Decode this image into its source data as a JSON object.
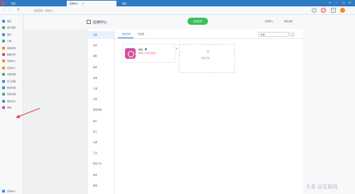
{
  "tabs": [
    {
      "label": "首页"
    },
    {
      "label": "应用中心",
      "close": "✕"
    },
    {
      "label": "审批"
    }
  ],
  "window": {
    "menu": "≡",
    "minimize": "–",
    "maximize": "□",
    "close": "✕"
  },
  "addressbar": {
    "crumb": "首页应用 · 应用中心",
    "badge": "11"
  },
  "sidebar": {
    "collapse": "«",
    "items": [
      {
        "label": "首页",
        "color": "#3c8be0"
      },
      {
        "label": "客户经营",
        "color": "#3cb37a"
      },
      {
        "label": "通讯",
        "color": "#3c8be0"
      },
      {
        "label": "订单",
        "color": "#3cb37a"
      },
      {
        "label": "审批应用",
        "color": "#f08a24"
      },
      {
        "label": "数据分析",
        "color": "#e5474f"
      },
      {
        "label": "商品中心",
        "color": "#f08a24"
      },
      {
        "label": "任务中心",
        "color": "#f08a24"
      },
      {
        "label": "仓库管理",
        "color": "#3cb37a"
      },
      {
        "label": "员工管理",
        "color": "#3c8be0"
      },
      {
        "label": "物流管理",
        "color": "#3c8be0"
      },
      {
        "label": "财务管理",
        "color": "#3cb37a"
      },
      {
        "label": "报表中心",
        "color": "#3c8be0"
      },
      {
        "label": "审批",
        "color": "#d34f9b"
      }
    ],
    "footer": "应用中心"
  },
  "header": {
    "title": "应用中心",
    "new_button": "新建应用",
    "link_1": "应用导入",
    "link_2": "更多应用"
  },
  "categories": [
    "全部",
    "协同",
    "销售",
    "财务",
    "采购",
    "人事",
    "行政",
    "项目管理",
    "客户",
    "员工",
    "仓库",
    "工具",
    "项目工作",
    "电商",
    "其他"
  ],
  "subtabs": [
    "我的应用",
    "已启用"
  ],
  "search": {
    "value": "搜索"
  },
  "app_card": {
    "name": "审批",
    "subtitle": "所有人可见已启用",
    "pin": "★"
  },
  "add_card": {
    "plus": "+",
    "label": "添加应用"
  },
  "watermark": "头条 @互联网",
  "colors": {
    "accent": "#2d7bc4",
    "primary_button": "#3dbf5b",
    "app_icon": "#d34f9b",
    "annotation_arrow": "#d6453a"
  }
}
